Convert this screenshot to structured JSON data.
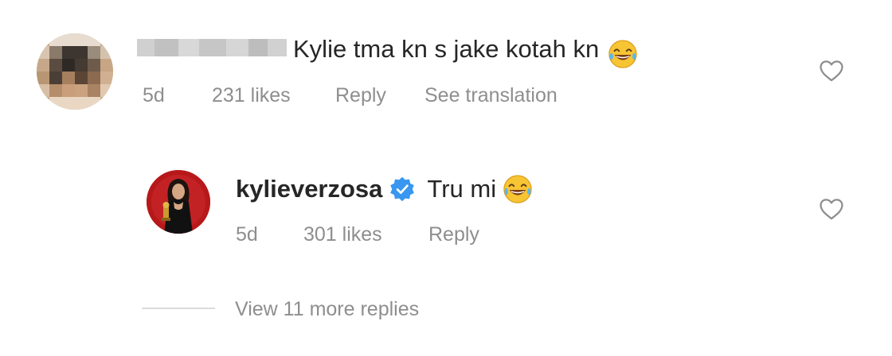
{
  "comment1": {
    "text": "Kylie tma kn s jake kotah kn",
    "emoji": "grinning-squinting-face-with-tears",
    "time": "5d",
    "likes": "231 likes",
    "reply_label": "Reply",
    "translation_label": "See translation"
  },
  "comment2": {
    "username": "kylieverzosa",
    "verified": true,
    "text": "Tru mi",
    "emoji": "grinning-squinting-face-with-tears",
    "time": "5d",
    "likes": "301 likes",
    "reply_label": "Reply"
  },
  "view_more_label": "View 11 more replies",
  "colors": {
    "text": "#262626",
    "meta": "#8e8e8e",
    "verified_blue": "#3897f0",
    "divider": "#dbdbdb"
  }
}
